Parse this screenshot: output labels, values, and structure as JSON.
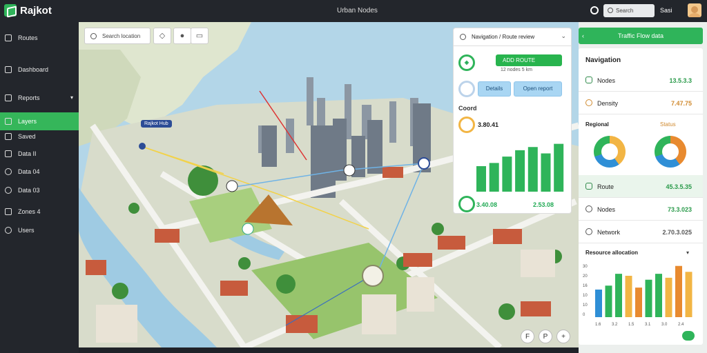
{
  "topbar": {
    "app_name": "Rajkot",
    "title": "Urban Nodes",
    "search_placeholder": "Search",
    "user_label": "Sasi"
  },
  "sidebar": {
    "items": [
      {
        "label": "Routes",
        "icon": "arrow-icon",
        "active": false
      },
      {
        "label": "Dashboard",
        "icon": "home-icon",
        "active": false
      },
      {
        "label": "Reports",
        "icon": "doc-icon",
        "active": false
      },
      {
        "label": "Layers",
        "icon": "layers-icon",
        "active": true
      },
      {
        "label": "Saved",
        "icon": "square-icon",
        "active": false
      },
      {
        "label": "Data II",
        "icon": "square-icon",
        "active": false
      },
      {
        "label": "Data 04",
        "icon": "circle-icon",
        "active": false
      },
      {
        "label": "Data 03",
        "icon": "circle-icon",
        "active": false
      },
      {
        "label": "Zones 4",
        "icon": "square-icon",
        "active": false
      },
      {
        "label": "Users",
        "icon": "circle-icon",
        "active": false
      }
    ]
  },
  "map": {
    "search_value": "Search location",
    "tools": [
      "layers-icon",
      "marker-icon",
      "chat-icon"
    ],
    "labels": [
      "Rajkot Hub"
    ],
    "controls": [
      "F",
      "P",
      "+"
    ]
  },
  "midcard": {
    "header": "Navigation / Route review",
    "pill_title": "ADD ROUTE",
    "pill_sub": "12 nodes 5 km",
    "buttons": [
      "Details",
      "Open report"
    ],
    "section_title": "Coord",
    "ring_value": "3.80.41",
    "footer_value": "3.40.08",
    "footer_value2": "2.53.08",
    "chart_data": {
      "type": "bar",
      "values": [
        8,
        9,
        11,
        13,
        14,
        12,
        15
      ]
    }
  },
  "rightpanel": {
    "banner": "Traffic Flow data",
    "title": "Navigation",
    "rows_top": [
      {
        "label": "Nodes",
        "value": "13.5.3.3"
      },
      {
        "label": "Density",
        "value": "7.47.75"
      }
    ],
    "section_label": "Regional",
    "section_status": "Status",
    "donuts": [
      {
        "colors": [
          "#f2b544",
          "#2f8fd6",
          "#2fb45a"
        ]
      },
      {
        "colors": [
          "#e88a2f",
          "#2f8fd6",
          "#2fb45a"
        ]
      }
    ],
    "rows_bottom": [
      {
        "label": "Route",
        "value": "45.3.5.35"
      },
      {
        "label": "Nodes",
        "value": "73.3.023"
      },
      {
        "label": "Network",
        "value": "2.70.3.025"
      }
    ],
    "chart_title": "Resource allocation",
    "chart_axis": [
      "30",
      "20",
      "16",
      "10",
      "10",
      "0"
    ],
    "chart_data": {
      "type": "bar",
      "categories": [
        "1.6",
        "3.2",
        "1.5",
        "3.1",
        "3.0",
        "2.4"
      ],
      "values": [
        14,
        16,
        22,
        21,
        15,
        19,
        22,
        20,
        26,
        23
      ],
      "colors": [
        "#2f8fd6",
        "#2fb45a",
        "#2fb45a",
        "#f2b544",
        "#e88a2f",
        "#2fb45a",
        "#2fb45a",
        "#f2b544",
        "#e88a2f",
        "#f2b544"
      ]
    }
  }
}
